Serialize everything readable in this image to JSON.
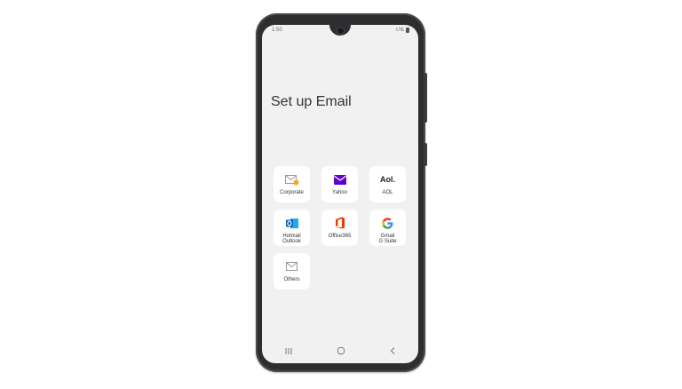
{
  "status": {
    "time": "1:50",
    "signal": "LTE"
  },
  "screen_title": "Set up Email",
  "providers": [
    {
      "label": "Corporate",
      "icon": "envelope-gear-icon"
    },
    {
      "label": "Yahoo",
      "icon": "yahoo-mail-icon"
    },
    {
      "label": "AOL",
      "icon": "aol-logo",
      "logo_text": "Aol."
    },
    {
      "label": "Hotmail\nOutlook",
      "icon": "outlook-icon"
    },
    {
      "label": "Office365",
      "icon": "office365-icon"
    },
    {
      "label": "Gmail\nG Suite",
      "icon": "google-g-icon"
    },
    {
      "label": "Others",
      "icon": "envelope-icon"
    }
  ],
  "colors": {
    "yahoo": "#5f01d1",
    "outlook": "#0364b8",
    "office": "#eb3c00",
    "google_blue": "#4285f4",
    "google_red": "#ea4335",
    "google_yellow": "#fbbc05",
    "google_green": "#34a853"
  }
}
